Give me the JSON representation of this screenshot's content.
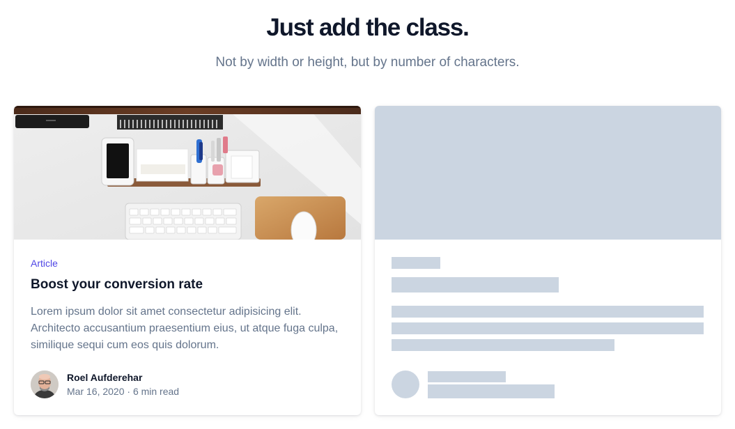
{
  "hero": {
    "title": "Just add the class.",
    "subtitle": "Not by width or height, but by number of characters."
  },
  "article_card": {
    "image_icon": "desk-workspace-photo",
    "category": "Article",
    "title": "Boost your conversion rate",
    "excerpt": "Lorem ipsum dolor sit amet consectetur adipisicing elit. Architecto accusantium praesentium eius, ut atque fuga culpa, similique sequi cum eos quis dolorum.",
    "author": {
      "avatar_icon": "author-portrait",
      "name": "Roel Aufderehar",
      "meta": "Mar 16, 2020 · 6 min read"
    }
  },
  "skeleton_card": {
    "placeholder_color": "#cbd5e1"
  },
  "colors": {
    "accent": "#4f46e5",
    "heading": "#0f172a",
    "muted": "#64748b"
  }
}
